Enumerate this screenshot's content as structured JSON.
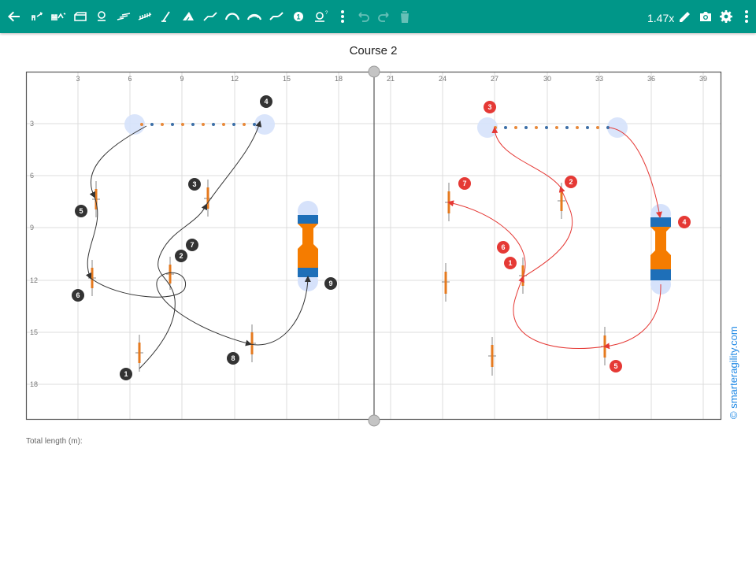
{
  "toolbar": {
    "color": "#009688",
    "zoom": "1.47x",
    "icons": [
      "back-arrow-icon",
      "jump-tool-icon",
      "double-jump-tool-icon",
      "wall-tool-icon",
      "tire-tool-icon",
      "long-jump-tool-icon",
      "weave-tool-icon",
      "pole-tool-icon",
      "a-frame-tool-icon",
      "dogwalk-tool-icon",
      "tunnel-tool-icon",
      "tunnel-curved-tool-icon",
      "chute-tool-icon",
      "number-tool-icon",
      "table-tool-icon",
      "more-tools-icon",
      "undo-icon",
      "redo-icon",
      "delete-icon",
      "edit-icon",
      "camera-icon",
      "settings-icon",
      "more-vert-icon"
    ]
  },
  "course": {
    "title": "Course 2",
    "total_length_label": "Total length (m):",
    "credit": "© smarteragility.com"
  },
  "grid": {
    "top_labels": [
      "3",
      "6",
      "9",
      "12",
      "15",
      "18",
      "21",
      "24",
      "27",
      "30",
      "33",
      "36",
      "39"
    ],
    "side_labels": [
      "3",
      "6",
      "9",
      "12",
      "15",
      "18"
    ]
  },
  "left_numbers": [
    "1",
    "2",
    "3",
    "4",
    "5",
    "6",
    "7",
    "8",
    "9"
  ],
  "right_numbers": [
    "1",
    "2",
    "3",
    "4",
    "5",
    "6",
    "7"
  ],
  "colors": {
    "dark_path": "#333333",
    "red_path": "#e53935",
    "tunnel_orange": "#f57c00",
    "tunnel_blue": "#1e6fb8",
    "jump_orange": "#e57a1f",
    "weave_orange": "#e57a1f",
    "weave_blue": "#3c6fa8"
  }
}
